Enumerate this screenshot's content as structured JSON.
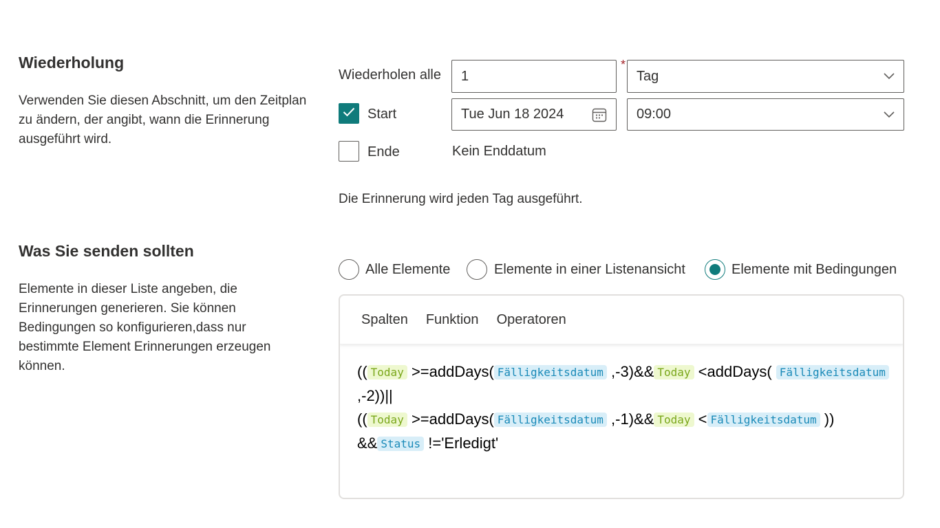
{
  "recurrence": {
    "title": "Wiederholung",
    "description": "Verwenden Sie diesen Abschnitt, um den Zeitplan zu ändern, der angibt, wann die Erinnerung ausgeführt wird.",
    "repeat_label": "Wiederholen alle",
    "repeat_value": "1",
    "required_marker": "*",
    "unit_value": "Tag",
    "start_label": "Start",
    "start_checked": true,
    "start_date": "Tue Jun 18 2024",
    "start_time": "09:00",
    "end_label": "Ende",
    "end_checked": false,
    "end_value": "Kein Enddatum",
    "summary": "Die Erinnerung wird jeden Tag ausgeführt."
  },
  "send": {
    "title": "Was Sie senden sollten",
    "description": "Elemente in dieser Liste angeben, die Erinnerungen generieren. Sie können Bedingungen so konfigurieren,dass nur bestimmte Element Erinnerungen erzeugen können.",
    "options": [
      {
        "label": "Alle Elemente",
        "selected": false
      },
      {
        "label": "Elemente in einer Listenansicht",
        "selected": false
      },
      {
        "label": "Elemente mit Bedingungen",
        "selected": true
      }
    ]
  },
  "editor": {
    "tabs": [
      "Spalten",
      "Funktion",
      "Operatoren"
    ],
    "formula": [
      {
        "t": "text",
        "v": "(("
      },
      {
        "t": "fn",
        "v": "Today"
      },
      {
        "t": "text",
        "v": " >=addDays("
      },
      {
        "t": "col",
        "v": "Fälligkeitsdatum"
      },
      {
        "t": "text",
        "v": " ,-3)&&"
      },
      {
        "t": "fn",
        "v": "Today"
      },
      {
        "t": "text",
        "v": " <addDays( "
      },
      {
        "t": "col",
        "v": "Fälligkeitsdatum"
      },
      {
        "t": "text",
        "v": " ,-2))||"
      },
      {
        "t": "br"
      },
      {
        "t": "text",
        "v": "(("
      },
      {
        "t": "fn",
        "v": "Today"
      },
      {
        "t": "text",
        "v": " >=addDays("
      },
      {
        "t": "col",
        "v": "Fälligkeitsdatum"
      },
      {
        "t": "text",
        "v": " ,-1)&&"
      },
      {
        "t": "fn",
        "v": "Today"
      },
      {
        "t": "text",
        "v": " <"
      },
      {
        "t": "col",
        "v": "Fälligkeitsdatum"
      },
      {
        "t": "text",
        "v": " ))"
      },
      {
        "t": "br"
      },
      {
        "t": "text",
        "v": "&&"
      },
      {
        "t": "col",
        "v": "Status"
      },
      {
        "t": "text",
        "v": " !='Erledigt'"
      }
    ]
  },
  "colors": {
    "accent": "#0f7b7b",
    "function_token_bg": "#eef8cf",
    "column_token_bg": "#d8eef8"
  },
  "icons": {
    "calendar": "calendar-icon",
    "dropdown": "chevron-down-icon",
    "check": "checkmark-icon"
  }
}
